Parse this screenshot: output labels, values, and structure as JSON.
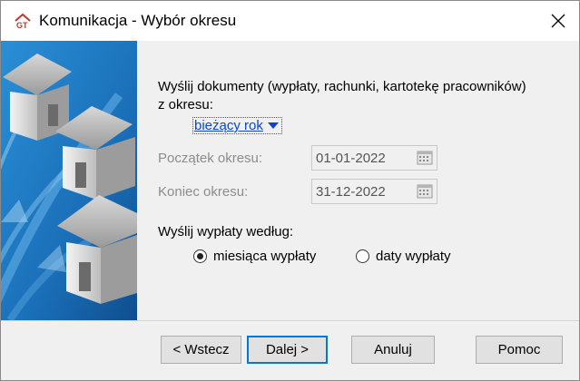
{
  "window": {
    "title": "Komunikacja - Wybór okresu",
    "app_icon": "gt-logo-icon",
    "close_icon": "close-icon"
  },
  "main": {
    "send_documents_label_line1": "Wyślij dokumenty (wypłaty, rachunki, kartotekę pracowników)",
    "send_documents_label_line2": "z okresu:",
    "period_selector": "bieżący rok",
    "period_start_label": "Początek okresu:",
    "period_start_value": "01-01-2022",
    "period_end_label": "Koniec okresu:",
    "period_end_value": "31-12-2022",
    "send_payouts_label": "Wyślij wypłaty według:",
    "radio_options": [
      {
        "label": "miesiąca wypłaty",
        "checked": true
      },
      {
        "label": "daty wypłaty",
        "checked": false
      }
    ]
  },
  "buttons": {
    "back": "< Wstecz",
    "next": "Dalej >",
    "cancel": "Anuluj",
    "help": "Pomoc"
  },
  "colors": {
    "link": "#0b45c8",
    "side_blue": "#1c7fc7",
    "accent_border": "#0078d7"
  }
}
